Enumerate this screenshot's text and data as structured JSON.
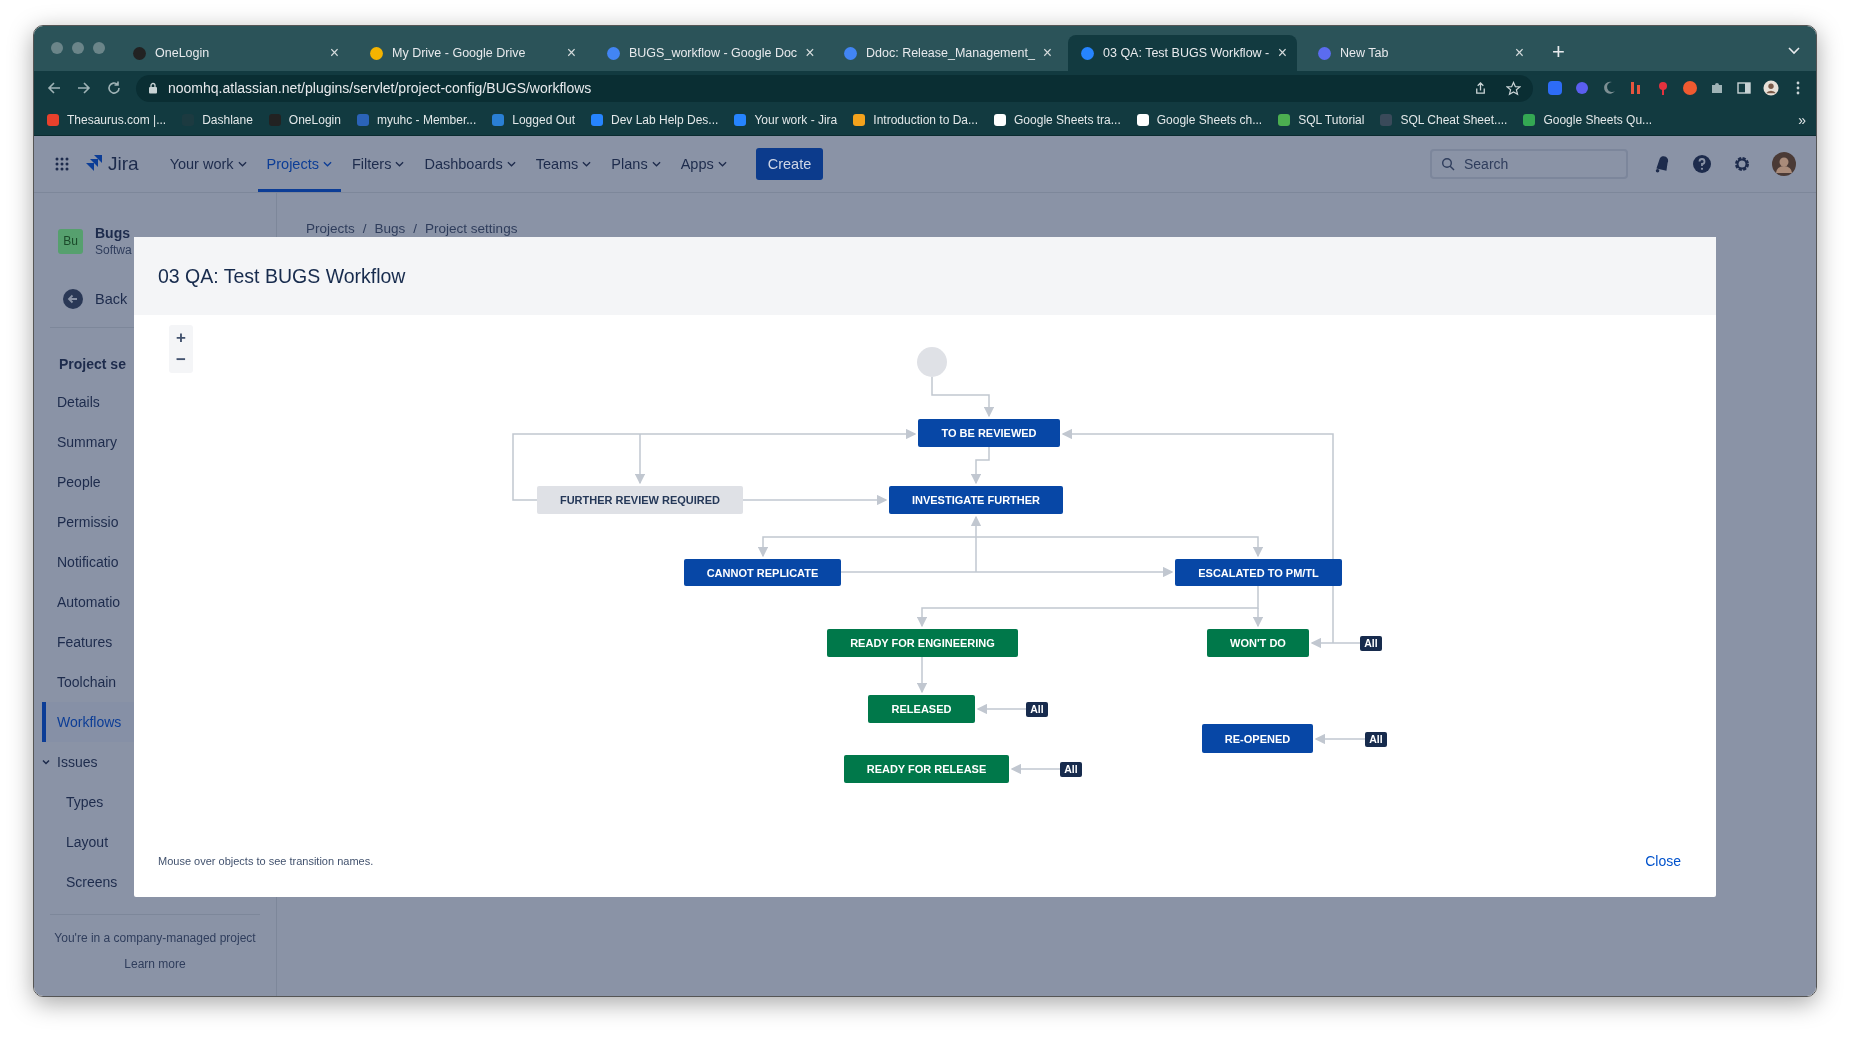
{
  "browser": {
    "tabs": [
      {
        "title": "OneLogin",
        "selected": false,
        "color": "#222222"
      },
      {
        "title": "My Drive - Google Drive",
        "selected": false,
        "color": "#f4b400"
      },
      {
        "title": "BUGS_workflow - Google Doc",
        "selected": false,
        "color": "#4285f4"
      },
      {
        "title": "Ddoc: Release_Management_",
        "selected": false,
        "color": "#4285f4"
      },
      {
        "title": "03 QA: Test BUGS Workflow -",
        "selected": true,
        "color": "#2684ff"
      },
      {
        "title": "New Tab",
        "selected": false,
        "color": "#5b6cf0"
      }
    ],
    "close_glyph": "×",
    "new_tab": "+",
    "address": "noomhq.atlassian.net/plugins/servlet/project-config/BUGS/workflows",
    "bookmarks": [
      {
        "label": "Thesaurus.com |...",
        "color": "#e8412c"
      },
      {
        "label": "Dashlane",
        "color": "#1c3a40"
      },
      {
        "label": "OneLogin",
        "color": "#222222"
      },
      {
        "label": "myuhc - Member...",
        "color": "#2b63b8"
      },
      {
        "label": "Logged Out",
        "color": "#2a7fd4"
      },
      {
        "label": "Dev Lab Help Des...",
        "color": "#2684ff"
      },
      {
        "label": "Your work - Jira",
        "color": "#2684ff"
      },
      {
        "label": "Introduction to Da...",
        "color": "#f4a21c"
      },
      {
        "label": "Google Sheets tra...",
        "color": "#ffffff"
      },
      {
        "label": "Google Sheets ch...",
        "color": "#ffffff"
      },
      {
        "label": "SQL Tutorial",
        "color": "#4caf50"
      },
      {
        "label": "SQL Cheat Sheet....",
        "color": "#3a4a5a"
      },
      {
        "label": "Google Sheets Qu...",
        "color": "#34a853"
      }
    ],
    "more_bookmarks": "»"
  },
  "jira": {
    "brand": "Jira",
    "nav": [
      {
        "label": "Your work",
        "selected": false
      },
      {
        "label": "Projects",
        "selected": true
      },
      {
        "label": "Filters",
        "selected": false
      },
      {
        "label": "Dashboards",
        "selected": false
      },
      {
        "label": "Teams",
        "selected": false
      },
      {
        "label": "Plans",
        "selected": false
      },
      {
        "label": "Apps",
        "selected": false
      }
    ],
    "create": "Create",
    "search": {
      "placeholder": "Search"
    },
    "project": {
      "badge": "Bu",
      "name": "Bugs",
      "type": "Softwa"
    },
    "back": "Back",
    "section": "Project se",
    "menu": [
      {
        "label": "Details",
        "selected": false
      },
      {
        "label": "Summary",
        "selected": false
      },
      {
        "label": "People",
        "selected": false
      },
      {
        "label": "Permissio",
        "selected": false
      },
      {
        "label": "Notificatio",
        "selected": false
      },
      {
        "label": "Automatio",
        "selected": false
      },
      {
        "label": "Features",
        "selected": false
      },
      {
        "label": "Toolchain",
        "selected": false
      },
      {
        "label": "Workflows",
        "selected": true
      },
      {
        "label": "Issues",
        "selected": false,
        "expanded": true,
        "children": [
          {
            "label": "Types",
            "selected": false
          },
          {
            "label": "Layout",
            "selected": false
          },
          {
            "label": "Screens",
            "selected": false
          }
        ]
      }
    ],
    "note": "You're in a company-managed project",
    "learn_more": "Learn more",
    "breadcrumbs": [
      "Projects",
      "Bugs",
      "Project settings"
    ],
    "separator": "/"
  },
  "modal": {
    "title": "03 QA: Test BUGS Workflow",
    "zoom_in": "+",
    "zoom_out": "−",
    "statuses": [
      {
        "label": "TO BE REVIEWED",
        "color": "#0747a6"
      },
      {
        "label": "FURTHER REVIEW REQUIRED",
        "color": "#dfe1e6"
      },
      {
        "label": "INVESTIGATE FURTHER",
        "color": "#0747a6"
      },
      {
        "label": "CANNOT REPLICATE",
        "color": "#0747a6"
      },
      {
        "label": "ESCALATED TO PM/TL",
        "color": "#0747a6"
      },
      {
        "label": "READY FOR ENGINEERING",
        "color": "#00784a"
      },
      {
        "label": "WON'T DO",
        "color": "#00784a",
        "badge": "All"
      },
      {
        "label": "RELEASED",
        "color": "#00784a",
        "badge": "All"
      },
      {
        "label": "RE-OPENED",
        "color": "#0747a6",
        "badge": "All"
      },
      {
        "label": "READY FOR RELEASE",
        "color": "#00784a",
        "badge": "All"
      }
    ],
    "hint": "Mouse over objects to see transition names.",
    "close": "Close"
  }
}
